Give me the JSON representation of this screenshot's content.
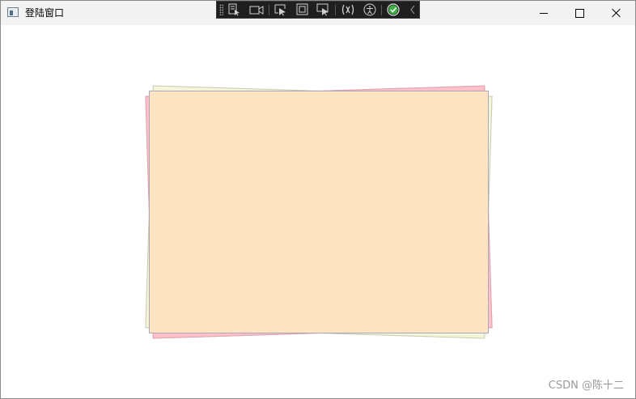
{
  "window": {
    "title": "登陆窗口",
    "icon": "app-window-icon"
  },
  "caption_buttons": [
    {
      "name": "minimize",
      "icon": "minimize-icon"
    },
    {
      "name": "maximize",
      "icon": "maximize-icon"
    },
    {
      "name": "close",
      "icon": "close-icon"
    }
  ],
  "debug_toolbar": {
    "tools": [
      "select-element-icon",
      "camera-icon",
      "pointer-select-icon",
      "layout-adorner-icon",
      "track-focus-icon",
      "binding-failures-icon",
      "accessibility-icon",
      "check-circle-icon",
      "collapse-chevron-icon"
    ]
  },
  "cards": [
    {
      "name": "back-card-pink",
      "color": "#ffc0cb"
    },
    {
      "name": "back-card-cream",
      "color": "#f5f5dc"
    },
    {
      "name": "front-card",
      "color": "#ffe4c4"
    }
  ],
  "watermark": "CSDN @陈十二"
}
